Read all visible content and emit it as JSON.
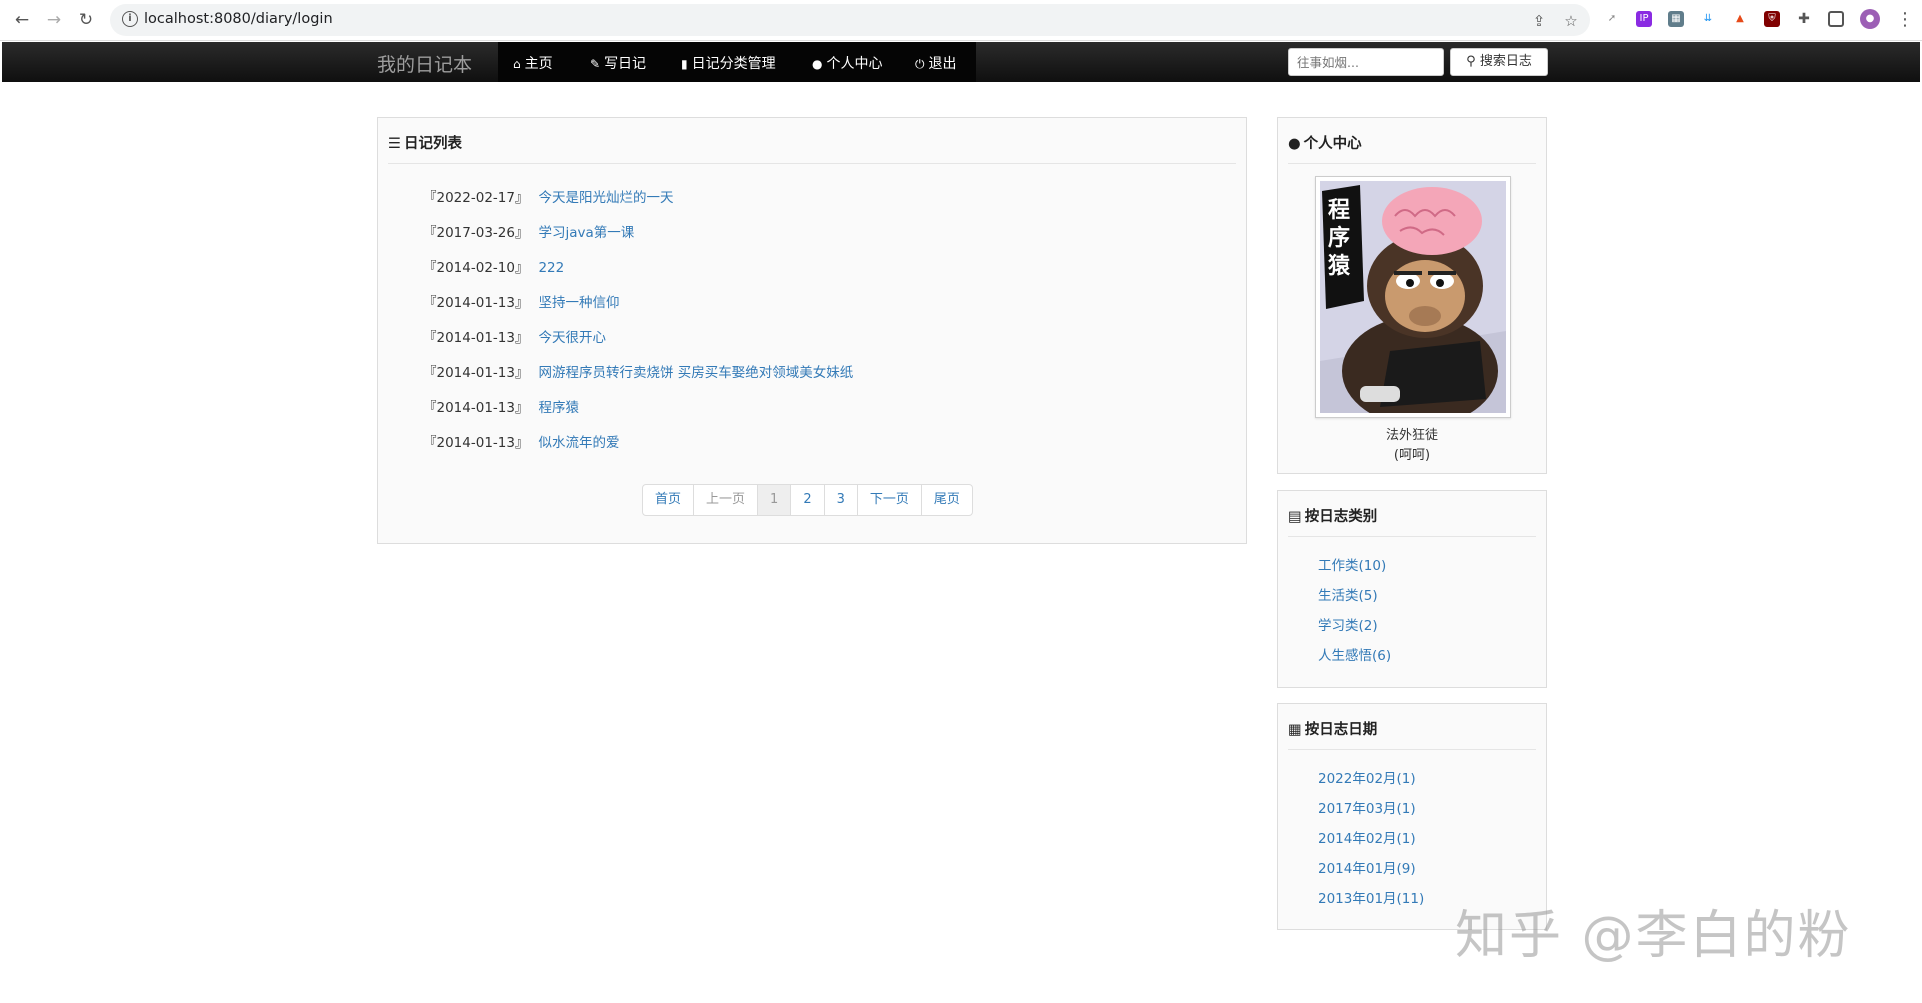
{
  "browser": {
    "url": "localhost:8080/diary/login"
  },
  "navbar": {
    "brand": "我的日记本",
    "items": [
      {
        "label": "主页",
        "icon": "home-icon"
      },
      {
        "label": "写日记",
        "icon": "pencil-icon"
      },
      {
        "label": "日记分类管理",
        "icon": "book-icon"
      },
      {
        "label": "个人中心",
        "icon": "user-icon"
      },
      {
        "label": "退出",
        "icon": "power-icon"
      }
    ],
    "search_placeholder": "往事如烟...",
    "search_button": "搜索日志"
  },
  "diary_panel": {
    "title": "日记列表",
    "entries": [
      {
        "date": "『2022-02-17』",
        "title": "今天是阳光灿烂的一天"
      },
      {
        "date": "『2017-03-26』",
        "title": "学习java第一课"
      },
      {
        "date": "『2014-02-10』",
        "title": "222"
      },
      {
        "date": "『2014-01-13』",
        "title": "坚持一种信仰"
      },
      {
        "date": "『2014-01-13』",
        "title": "今天很开心"
      },
      {
        "date": "『2014-01-13』",
        "title": "网游程序员转行卖烧饼 买房买车娶绝对领域美女妹纸"
      },
      {
        "date": "『2014-01-13』",
        "title": "程序猿"
      },
      {
        "date": "『2014-01-13』",
        "title": "似水流年的爱"
      }
    ],
    "pager": {
      "first": "首页",
      "prev": "上一页",
      "pages": [
        "1",
        "2",
        "3"
      ],
      "current": "1",
      "next": "下一页",
      "last": "尾页"
    }
  },
  "profile_panel": {
    "title": "个人中心",
    "avatar_text": "程序猿",
    "nickname": "法外狂徒",
    "signature": "(呵呵)"
  },
  "category_panel": {
    "title": "按日志类别",
    "items": [
      "工作类(10)",
      "生活类(5)",
      "学习类(2)",
      "人生感悟(6)"
    ]
  },
  "date_panel": {
    "title": "按日志日期",
    "items": [
      "2022年02月(1)",
      "2017年03月(1)",
      "2014年02月(1)",
      "2014年01月(9)",
      "2013年01月(11)"
    ]
  },
  "watermark": "知乎 @李白的粉"
}
